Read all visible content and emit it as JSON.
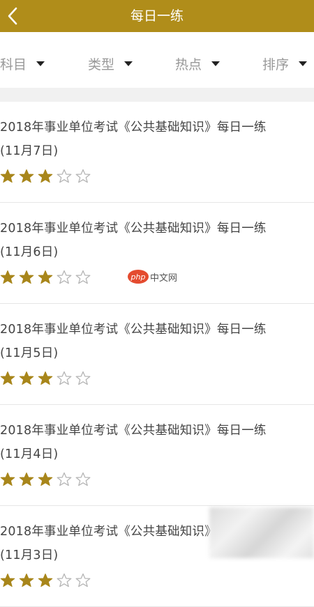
{
  "header": {
    "title": "每日一练",
    "background": "#b08d1a"
  },
  "filters": [
    {
      "label": "科目"
    },
    {
      "label": "类型"
    },
    {
      "label": "热点"
    },
    {
      "label": "排序"
    }
  ],
  "items": [
    {
      "title_line1": "2018年事业单位考试《公共基础知识》每日一练",
      "title_line2": "(11月7日)",
      "rating": 3,
      "max_rating": 5
    },
    {
      "title_line1": "2018年事业单位考试《公共基础知识》每日一练",
      "title_line2": "(11月6日)",
      "rating": 3,
      "max_rating": 5
    },
    {
      "title_line1": "2018年事业单位考试《公共基础知识》每日一练",
      "title_line2": "(11月5日)",
      "rating": 3,
      "max_rating": 5
    },
    {
      "title_line1": "2018年事业单位考试《公共基础知识》每日一练",
      "title_line2": "(11月4日)",
      "rating": 3,
      "max_rating": 5
    },
    {
      "title_line1": "2018年事业单位考试《公共基础知识》每日一练",
      "title_line2": "(11月3日)",
      "rating": 3,
      "max_rating": 5
    }
  ],
  "watermark": {
    "logo": "php",
    "text": "中文网"
  },
  "colors": {
    "accent": "#b08d1a",
    "star_filled": "#a8861b",
    "star_empty": "#b5b5b5"
  }
}
